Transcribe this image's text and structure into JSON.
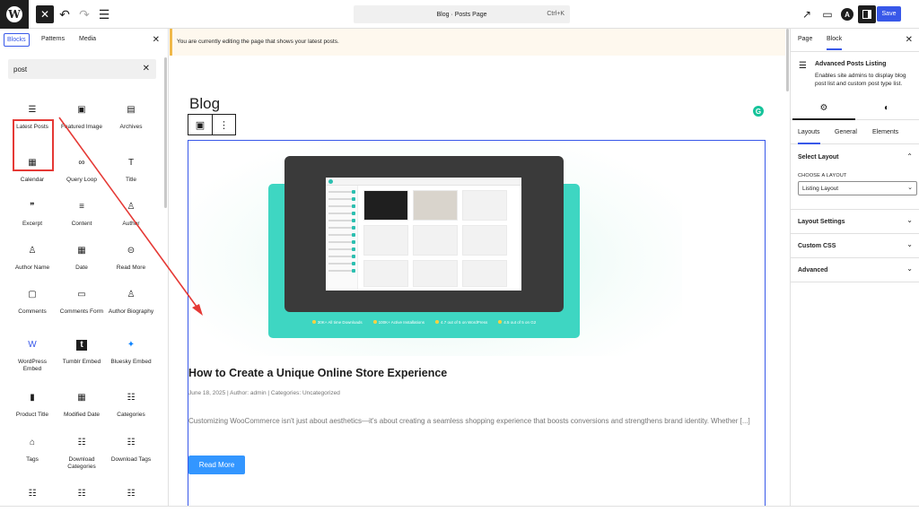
{
  "topbar": {
    "logo_glyph": "W",
    "close_glyph": "✕",
    "undo_glyph": "↶",
    "redo_glyph": "↷",
    "list_glyph": "☰",
    "command_label": "Blog · Posts Page",
    "command_shortcut": "Ctrl+K",
    "view_glyph": "↗",
    "desktop_glyph": "▭",
    "astra_glyph": "A",
    "save_label": "Save"
  },
  "inserter": {
    "tabs": [
      "Blocks",
      "Patterns",
      "Media"
    ],
    "close_glyph": "✕",
    "search_value": "post",
    "clear_glyph": "✕",
    "blocks": [
      {
        "label": "Latest Posts",
        "icon": "☰"
      },
      {
        "label": "Featured Image",
        "icon": "▣"
      },
      {
        "label": "Archives",
        "icon": "▤"
      },
      {
        "label": "Calendar",
        "icon": "▦"
      },
      {
        "label": "Query Loop",
        "icon": "∞"
      },
      {
        "label": "Title",
        "icon": "T"
      },
      {
        "label": "Excerpt",
        "icon": "❞"
      },
      {
        "label": "Content",
        "icon": "≡"
      },
      {
        "label": "Author",
        "icon": "♙"
      },
      {
        "label": "Author Name",
        "icon": "♙"
      },
      {
        "label": "Date",
        "icon": "▦"
      },
      {
        "label": "Read More",
        "icon": "⊝"
      },
      {
        "label": "Comments",
        "icon": "▢"
      },
      {
        "label": "Comments Form",
        "icon": "▭"
      },
      {
        "label": "Author Biography",
        "icon": "♙"
      },
      {
        "label": "WordPress Embed",
        "icon": "W"
      },
      {
        "label": "Tumblr Embed",
        "icon": "t"
      },
      {
        "label": "Bluesky Embed",
        "icon": "✦"
      },
      {
        "label": "Product Title",
        "icon": "▮"
      },
      {
        "label": "Modified Date",
        "icon": "▦"
      },
      {
        "label": "Categories",
        "icon": "☷"
      },
      {
        "label": "Tags",
        "icon": "⌂"
      },
      {
        "label": "Download Categories",
        "icon": "☷"
      },
      {
        "label": "Download Tags",
        "icon": "☷"
      },
      {
        "label": "",
        "icon": "☷"
      },
      {
        "label": "",
        "icon": "☷"
      },
      {
        "label": "",
        "icon": "☷"
      }
    ]
  },
  "notice": {
    "text": "You are currently editing the page that shows your latest posts."
  },
  "canvas": {
    "page_title": "Blog",
    "toolbar_icon": "▣",
    "toolbar_more": "⋮",
    "grammarly_glyph": "G",
    "post": {
      "badges": [
        "30K+ All time Downloads",
        "100K+ Active Installations",
        "4.7 out of 5 on WordPress",
        "4.5 out of 5 on G2"
      ],
      "title": "How to Create a Unique Online Store Experience",
      "meta": "June 18, 2025 | Author: admin | Categories: Uncategorized",
      "excerpt": "Customizing WooCommerce isn't just about aesthetics—it's about creating a seamless shopping experience that boosts conversions and strengthens brand identity. Whether [...]",
      "read_more": "Read More"
    }
  },
  "sidebar": {
    "tabs": [
      "Page",
      "Block"
    ],
    "close_glyph": "✕",
    "block_icon": "☰",
    "block_name": "Advanced Posts Listing",
    "block_desc": "Enables site admins to display blog post list and custom post type list.",
    "settings_glyph": "⚙",
    "styles_glyph": "◐",
    "subtabs": [
      "Layouts",
      "General",
      "Elements"
    ],
    "panels": {
      "select_layout": "Select Layout",
      "choose_label": "CHOOSE A LAYOUT",
      "layout_value": "Listing Layout",
      "layout_settings": "Layout Settings",
      "custom_css": "Custom CSS",
      "advanced": "Advanced"
    },
    "chevron_up": "⌃",
    "chevron_down": "⌄"
  },
  "colors": {
    "accent": "#3858e9",
    "highlight": "#e53935",
    "read_more": "#3396ff",
    "teal": "#3ed6c2"
  }
}
